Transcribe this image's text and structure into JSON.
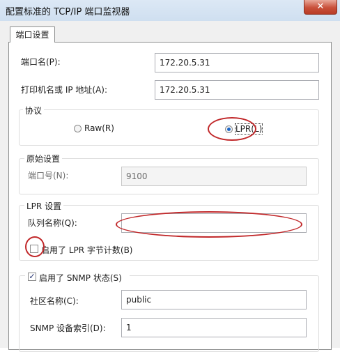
{
  "window": {
    "title": "配置标准的 TCP/IP 端口监视器",
    "close_glyph": "✕"
  },
  "tabs": [
    {
      "label": "端口设置"
    }
  ],
  "port_name": {
    "label": "端口名(P):",
    "value": "172.20.5.31"
  },
  "printer_address": {
    "label": "打印机名或 IP 地址(A):",
    "value": "172.20.5.31"
  },
  "protocol": {
    "legend": "协议",
    "options": [
      {
        "label": "Raw(R)",
        "selected": false
      },
      {
        "label": "LPR(L)",
        "selected": true
      }
    ]
  },
  "raw_settings": {
    "legend": "原始设置",
    "port_number": {
      "label": "端口号(N):",
      "value": "9100"
    }
  },
  "lpr_settings": {
    "legend": "LPR 设置",
    "queue_name": {
      "label": "队列名称(Q):",
      "value": ""
    },
    "byte_count": {
      "label": "启用了 LPR 字节计数(B)",
      "checked": false
    }
  },
  "snmp": {
    "enable_label": "启用了 SNMP 状态(S)",
    "enabled": true,
    "community": {
      "label": "社区名称(C):",
      "value": "public"
    },
    "device_index": {
      "label": "SNMP 设备索引(D):",
      "value": "1"
    }
  },
  "annotation_color": "#c1282a",
  "accent_color": "#1b66c9"
}
